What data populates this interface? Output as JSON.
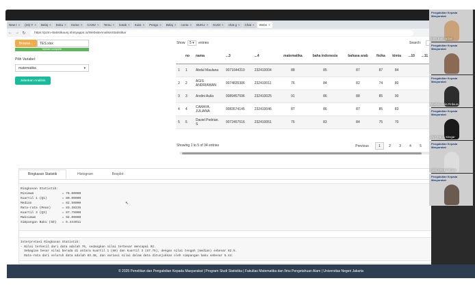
{
  "browser": {
    "tabs": [
      {
        "label": "New t"
      },
      {
        "label": "(23) Y"
      },
      {
        "label": "Belaj"
      },
      {
        "label": "Doku"
      },
      {
        "label": "Home"
      },
      {
        "label": "CANV"
      },
      {
        "label": "Temu"
      },
      {
        "label": "kotak"
      },
      {
        "label": "Kuisi"
      },
      {
        "label": "Pengo"
      },
      {
        "label": "Belaj"
      },
      {
        "label": "conto"
      },
      {
        "label": "BUKU"
      },
      {
        "label": "KUDI"
      },
      {
        "label": "chat g"
      },
      {
        "label": "Chat"
      },
      {
        "label": "Webs",
        "active": true
      }
    ],
    "url": "https://p2m-statistikaunj.shinyapps.io/WebsiteAnalisisStatistika/"
  },
  "upload": {
    "browse_label": "Browse...",
    "file_name": "TES.xlsx",
    "progress_text": "Upload complete",
    "progress": 1.0
  },
  "variable": {
    "label": "Pilih Variabel:",
    "selected": "matematika"
  },
  "run_button": "Jalankan Analisis",
  "datatable": {
    "show_label": "Show",
    "page_length": "5",
    "entries_label": "entries",
    "search_label": "Search:",
    "columns": [
      "",
      "no",
      "nama",
      "...3",
      "...4",
      "matematika",
      "baha indonesia",
      "bahasa arab",
      "fisika",
      "kimia",
      "...10",
      "...11"
    ],
    "rows": [
      [
        "1",
        "1",
        "Abdul Maulana",
        "0071644310",
        "232410004",
        "88",
        "85",
        "87",
        "87",
        "84",
        "",
        ""
      ],
      [
        "2",
        "2",
        "AGIS ANDRIAWAN",
        "0074835306",
        "232410011",
        "76",
        "84",
        "82",
        "74",
        "80",
        "",
        ""
      ],
      [
        "3",
        "3",
        "Andini Aulia",
        "0089457596",
        "232410025",
        "91",
        "86",
        "88",
        "85",
        "90",
        "",
        ""
      ],
      [
        "4",
        "4",
        "CAHAYA JULIANA",
        "0083574145",
        "232410046",
        "87",
        "86",
        "87",
        "85",
        "83",
        "",
        ""
      ],
      [
        "5",
        "5",
        "Daviel Pedrian. S",
        "0072457516",
        "232410051",
        "76",
        "83",
        "84",
        "75",
        "70",
        "",
        ""
      ]
    ],
    "info": "Showing 1 to 5 of 34 entries",
    "pagination": {
      "previous": "Previous",
      "pages": [
        "1",
        "2",
        "3",
        "4",
        "5"
      ],
      "active": "1"
    }
  },
  "result_tabs": [
    {
      "label": "Ringkasan Statistik",
      "active": true
    },
    {
      "label": "Histogram"
    },
    {
      "label": "Boxplot"
    }
  ],
  "summary_lines": [
    "Ringkasan Statistik:",
    "Minimum               = 76.00000",
    "Kuartil 1 (Q1)        = 80.00000",
    "Median                = 82.50000",
    "Rata-rata (Mean)      = 83.38235",
    "Kuartil 3 (Q3)        = 87.75000",
    "Maksimum              = 92.00000",
    "Simpangan Baku (SD)   = 5.444011"
  ],
  "interpretation_lines": [
    "Interpretasi Ringkasan Statistik:",
    "- Nilai terkecil dari data adalah 76, sedangkan nilai terbesar mencapai 92.",
    "  Sebagian besar nilai berada di antara kuartil 1 (80) dan kuartil 3 (87.75), dengan nilai tengah (median) sebesar 82.5.",
    "  Rata-rata dari seluruh data adalah 83.38, dan variasi nilai dalam data ditunjukkan oleh simpangan baku sebesar 5.44."
  ],
  "footer": "© 2025 Penelitian dan Pengabdian Kepada Masyarakat | Program Studi Statistika | Fakultas Matematika dan Ilmu Pengetahuan Alam | Universitas Negeri Jakarta",
  "participants": {
    "banner": "Pengabdian Kepada Masyarakat",
    "names": [
      "Sinta Rahmadani",
      "",
      "Makhila Aulia Firdausi",
      "chi7_Dania Siregar",
      "Aulia Yusrat Fathiya",
      ""
    ]
  },
  "colors": {
    "browse": "#f0ad4e",
    "progress": "#5cb85c",
    "run_button": "#18bc9c",
    "footer": "#2c3e50"
  }
}
